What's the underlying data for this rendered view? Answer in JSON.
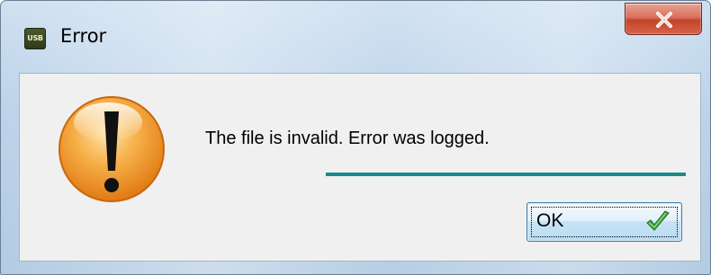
{
  "window": {
    "title": "Error",
    "app_icon_text": "USB",
    "app_icon": "usb-app-icon",
    "close_icon": "close-icon"
  },
  "dialog": {
    "icon": "warning-icon",
    "message": "The file is invalid. Error was logged.",
    "ok_label": "OK",
    "ok_icon": "checkmark-icon"
  },
  "colors": {
    "accent_line": "#1a8a8a",
    "close_button": "#c4432a",
    "warning_orange": "#f39a2b",
    "checkmark_green": "#3fa83c"
  }
}
